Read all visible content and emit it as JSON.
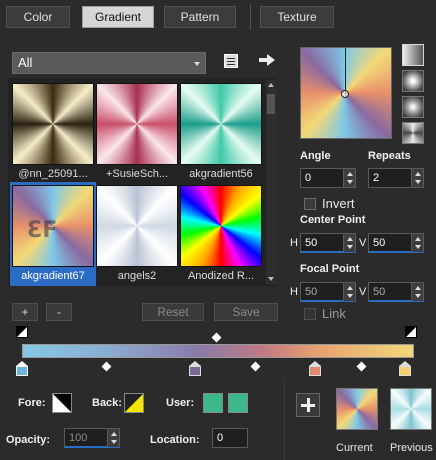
{
  "tabs": [
    {
      "label": "Color",
      "active": false
    },
    {
      "label": "Gradient",
      "active": true
    },
    {
      "label": "Pattern",
      "active": false
    },
    {
      "label": "Texture",
      "active": false
    }
  ],
  "category": {
    "selected": "All"
  },
  "gradients": [
    {
      "label": "@nn_25091...",
      "style": "conic-bronze",
      "selected": false
    },
    {
      "label": "+SusieSch...",
      "style": "conic-pink",
      "selected": false
    },
    {
      "label": "akgradient56",
      "style": "conic-teal",
      "selected": false
    },
    {
      "label": "akgradient67",
      "style": "conic-warm",
      "selected": true
    },
    {
      "label": "angels2",
      "style": "conic-white",
      "selected": false
    },
    {
      "label": "Anodized R...",
      "style": "conic-rainbow",
      "selected": false
    }
  ],
  "buttons": {
    "add": "+",
    "remove": "-",
    "reset": "Reset",
    "save": "Save"
  },
  "angle": {
    "label": "Angle",
    "value": "0"
  },
  "repeats": {
    "label": "Repeats",
    "value": "2"
  },
  "invert": {
    "label": "Invert",
    "checked": false
  },
  "center_point": {
    "label": "Center Point",
    "h_label": "H",
    "h": "50",
    "v_label": "V",
    "v": "50"
  },
  "focal_point": {
    "label": "Focal Point",
    "h_label": "H",
    "h": "50",
    "v_label": "V",
    "v": "50"
  },
  "link": {
    "label": "Link",
    "checked": false
  },
  "stops": {
    "fore_label": "Fore:",
    "back_label": "Back:",
    "user_label": "User:",
    "user_color": "#3db88a",
    "opacity_label": "Opacity:",
    "opacity": "100",
    "location_label": "Location:",
    "location": "0"
  },
  "preview": {
    "current_label": "Current",
    "previous_label": "Previous"
  },
  "colors": {
    "accent": "#2b6cc4",
    "bg": "#2b2b2b"
  }
}
